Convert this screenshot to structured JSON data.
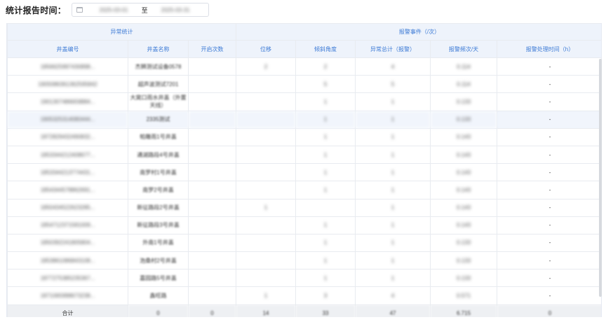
{
  "filter": {
    "label": "统计报告时间：",
    "start_date": "2025-03-01",
    "separator": "至",
    "end_date": "2025-03-31"
  },
  "table": {
    "group_headers": [
      {
        "label": "异常统计"
      },
      {
        "label": "报警事件（/次）"
      }
    ],
    "columns": [
      "井盖编号",
      "井盖名称",
      "开启次数",
      "位移",
      "倾斜角度",
      "异常总计（报警）",
      "报警频次/天",
      "报警处理时间（h）"
    ],
    "rows": [
      {
        "id": "1856625997430898...",
        "name": "杰狮测试设备0578",
        "open": "",
        "disp": "2",
        "tilt": "2",
        "total": "4",
        "freq": "0.114",
        "handle": "-"
      },
      {
        "id": "1905086361362595842",
        "name": "超声波测试7201",
        "open": "",
        "disp": "",
        "tilt": "5",
        "total": "5",
        "freq": "0.114",
        "handle": "-"
      },
      {
        "id": "1901307486659884...",
        "name": "大窝口雨水井盖（外置天线）",
        "open": "",
        "disp": "",
        "tilt": "1",
        "total": "1",
        "freq": "0.133",
        "handle": "-"
      },
      {
        "id": "1905325314080444...",
        "name": "2335测试",
        "open": "",
        "disp": "",
        "tilt": "1",
        "total": "1",
        "freq": "0.133",
        "handle": "-"
      },
      {
        "id": "1872829432490832...",
        "name": "帕雕雨1号井盖",
        "open": "",
        "disp": "",
        "tilt": "1",
        "total": "1",
        "freq": "0.143",
        "handle": "-"
      },
      {
        "id": "1853344212408677...",
        "name": "通湖路段4号井盖",
        "open": "",
        "disp": "",
        "tilt": "1",
        "total": "1",
        "freq": "0.143",
        "handle": "-"
      },
      {
        "id": "1853344213774431...",
        "name": "南罗村1号井盖",
        "open": "",
        "disp": "",
        "tilt": "1",
        "total": "1",
        "freq": "0.143",
        "handle": "-"
      },
      {
        "id": "1854344578862691...",
        "name": "南罗2号井盖",
        "open": "",
        "disp": "",
        "tilt": "1",
        "total": "1",
        "freq": "0.143",
        "handle": "-"
      },
      {
        "id": "1850434522623285...",
        "name": "新征路段2号井盖",
        "open": "",
        "disp": "1",
        "tilt": "",
        "total": "1",
        "freq": "0.143",
        "handle": "-"
      },
      {
        "id": "1854712371581009...",
        "name": "新征路段3号井盖",
        "open": "",
        "disp": "",
        "tilt": "1",
        "total": "1",
        "freq": "0.143",
        "handle": "-"
      },
      {
        "id": "1850392241805804...",
        "name": "外南1号井盖",
        "open": "",
        "disp": "",
        "tilt": "1",
        "total": "1",
        "freq": "0.133",
        "handle": "-"
      },
      {
        "id": "1853861086843108...",
        "name": "泡桑村2号井盖",
        "open": "",
        "disp": "",
        "tilt": "1",
        "total": "1",
        "freq": "0.133",
        "handle": "-"
      },
      {
        "id": "1877275385235367...",
        "name": "嘉园路5号井盖",
        "open": "",
        "disp": "",
        "tilt": "1",
        "total": "1",
        "freq": "0.133",
        "handle": "-"
      },
      {
        "id": "1871065998673238...",
        "name": "鑫旺路",
        "open": "",
        "disp": "1",
        "tilt": "3",
        "total": "4",
        "freq": "0.571",
        "handle": "-"
      }
    ],
    "footer": {
      "label": "合计",
      "name": "0",
      "open": "0",
      "disp": "14",
      "tilt": "33",
      "total": "47",
      "freq": "6.715",
      "handle": "0"
    }
  }
}
